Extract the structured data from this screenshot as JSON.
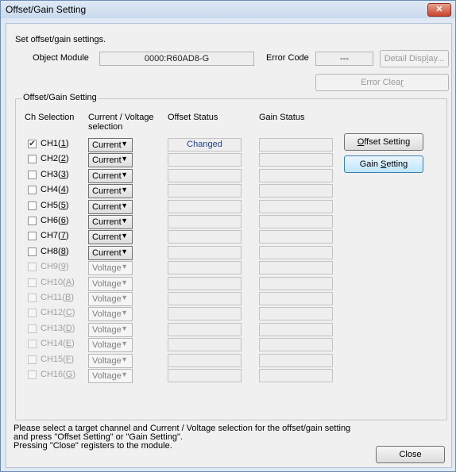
{
  "window": {
    "title": "Offset/Gain Setting",
    "close_glyph": "✕"
  },
  "instruction": "Set offset/gain settings.",
  "object_module": {
    "label": "Object Module",
    "value": "0000:R60AD8-G"
  },
  "error_code": {
    "label": "Error Code",
    "value": "---"
  },
  "buttons": {
    "detail_display": {
      "label": "Detail Display...",
      "pre": "Detail Disp",
      "key": "l",
      "post": "ay..."
    },
    "error_clear": {
      "label": "Error Clear",
      "pre": "Error Clea",
      "key": "r",
      "post": ""
    },
    "offset_setting": {
      "label": "Offset Setting",
      "pre": "",
      "key": "O",
      "post": "ffset Setting"
    },
    "gain_setting": {
      "label": "Gain Setting",
      "pre": "Gain ",
      "key": "S",
      "post": "etting"
    },
    "close": {
      "label": "Close"
    }
  },
  "group_title": "Offset/Gain Setting",
  "columns": {
    "ch": "Ch Selection",
    "cv": "Current / Voltage selection",
    "cv_line1": "Current / Voltage",
    "cv_line2": "selection",
    "offset": "Offset Status",
    "gain": "Gain Status"
  },
  "channels": [
    {
      "label": "CH1",
      "key": "1",
      "checked": true,
      "enabled": true,
      "mode": "Current",
      "offset_status": "Changed",
      "gain_status": ""
    },
    {
      "label": "CH2",
      "key": "2",
      "checked": false,
      "enabled": true,
      "mode": "Current",
      "offset_status": "",
      "gain_status": ""
    },
    {
      "label": "CH3",
      "key": "3",
      "checked": false,
      "enabled": true,
      "mode": "Current",
      "offset_status": "",
      "gain_status": ""
    },
    {
      "label": "CH4",
      "key": "4",
      "checked": false,
      "enabled": true,
      "mode": "Current",
      "offset_status": "",
      "gain_status": ""
    },
    {
      "label": "CH5",
      "key": "5",
      "checked": false,
      "enabled": true,
      "mode": "Current",
      "offset_status": "",
      "gain_status": ""
    },
    {
      "label": "CH6",
      "key": "6",
      "checked": false,
      "enabled": true,
      "mode": "Current",
      "offset_status": "",
      "gain_status": ""
    },
    {
      "label": "CH7",
      "key": "7",
      "checked": false,
      "enabled": true,
      "mode": "Current",
      "offset_status": "",
      "gain_status": ""
    },
    {
      "label": "CH8",
      "key": "8",
      "checked": false,
      "enabled": true,
      "mode": "Current",
      "offset_status": "",
      "gain_status": ""
    },
    {
      "label": "CH9",
      "key": "9",
      "checked": false,
      "enabled": false,
      "mode": "Voltage",
      "offset_status": "",
      "gain_status": ""
    },
    {
      "label": "CH10",
      "key": "A",
      "checked": false,
      "enabled": false,
      "mode": "Voltage",
      "offset_status": "",
      "gain_status": ""
    },
    {
      "label": "CH11",
      "key": "B",
      "checked": false,
      "enabled": false,
      "mode": "Voltage",
      "offset_status": "",
      "gain_status": ""
    },
    {
      "label": "CH12",
      "key": "C",
      "checked": false,
      "enabled": false,
      "mode": "Voltage",
      "offset_status": "",
      "gain_status": ""
    },
    {
      "label": "CH13",
      "key": "D",
      "checked": false,
      "enabled": false,
      "mode": "Voltage",
      "offset_status": "",
      "gain_status": ""
    },
    {
      "label": "CH14",
      "key": "E",
      "checked": false,
      "enabled": false,
      "mode": "Voltage",
      "offset_status": "",
      "gain_status": ""
    },
    {
      "label": "CH15",
      "key": "F",
      "checked": false,
      "enabled": false,
      "mode": "Voltage",
      "offset_status": "",
      "gain_status": ""
    },
    {
      "label": "CH16",
      "key": "G",
      "checked": false,
      "enabled": false,
      "mode": "Voltage",
      "offset_status": "",
      "gain_status": ""
    }
  ],
  "footer": {
    "line1": "Please select a target channel and Current / Voltage selection for the offset/gain setting",
    "line2": "and press \"Offset Setting\" or \"Gain Setting\".",
    "line3": "Pressing \"Close\" registers to the module."
  },
  "icons": {
    "checkbox_checked": "check-icon",
    "dropdown": "triangle-down-icon"
  },
  "colors": {
    "title_bar": "#c9d9ee",
    "close_button": "#c7442e",
    "changed_text": "#1f3f8f"
  }
}
